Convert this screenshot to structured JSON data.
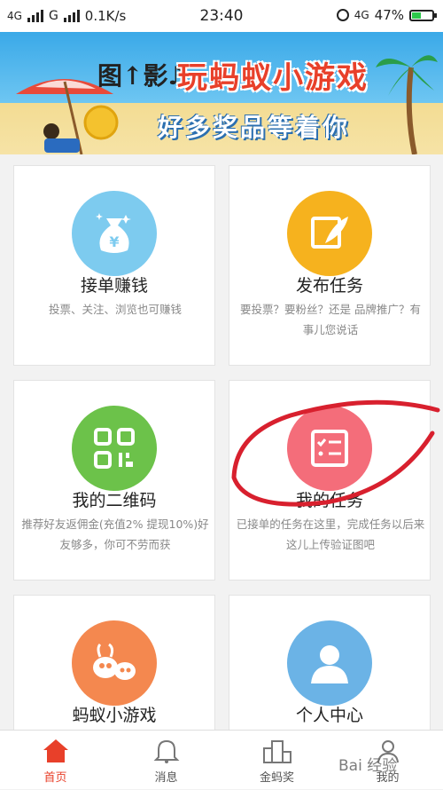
{
  "status_bar": {
    "network1": "4G",
    "network2": "G",
    "speed": "0.1K/s",
    "time": "23:40",
    "network3": "4G",
    "battery": "47%",
    "battery_level": 0.47
  },
  "banner": {
    "prefix": "图↑影♪",
    "title": "玩蚂蚁小游戏",
    "subtitle": "好多奖品等着你"
  },
  "cards": [
    {
      "title": "接单赚钱",
      "desc": "投票、关注、浏览也可赚钱",
      "color": "#7dcbef",
      "icon": "money-bag-icon"
    },
    {
      "title": "发布任务",
      "desc": "要投票？要粉丝？还是 品牌推广？有事儿您说话",
      "color": "#f6b21e",
      "icon": "edit-feather-icon"
    },
    {
      "title": "我的二维码",
      "desc": "推荐好友返佣金(充值2% 提现10%)好友够多，你可不劳而获",
      "color": "#6cc24a",
      "icon": "qr-code-icon"
    },
    {
      "title": "我的任务",
      "desc": "已接单的任务在这里，完成任务以后来这儿上传验证图吧",
      "color": "#f46d7a",
      "icon": "task-list-icon"
    },
    {
      "title": "蚂蚁小游戏",
      "desc": "",
      "color": "#f4884f",
      "icon": "ant-game-icon"
    },
    {
      "title": "个人中心",
      "desc": "",
      "color": "#6bb3e6",
      "icon": "user-icon"
    }
  ],
  "tabs": [
    {
      "label": "首页",
      "icon": "home-icon",
      "active": true
    },
    {
      "label": "消息",
      "icon": "bell-icon",
      "active": false
    },
    {
      "label": "金蚂奖",
      "icon": "podium-icon",
      "active": false
    },
    {
      "label": "我的",
      "icon": "profile-icon",
      "active": false
    }
  ],
  "watermark": "Bai 经验",
  "colors": {
    "accent": "#e8402a",
    "annotation": "#d8202e"
  }
}
